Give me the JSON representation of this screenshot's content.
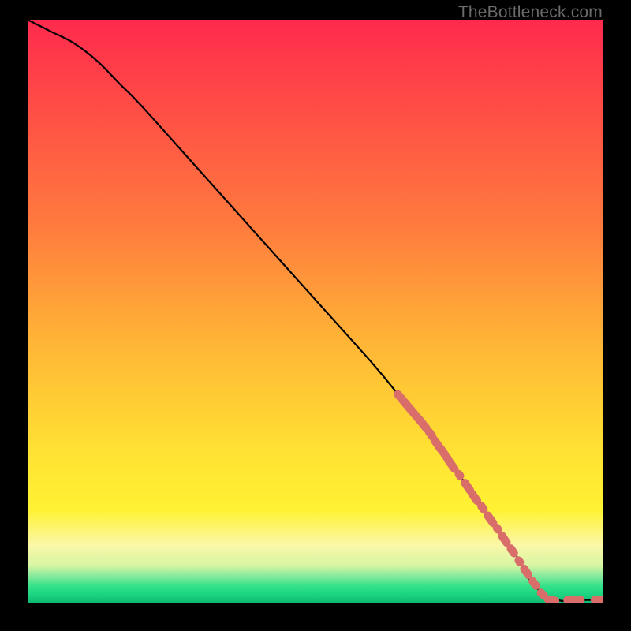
{
  "attribution": "TheBottleneck.com",
  "chart_data": {
    "type": "line",
    "title": "",
    "xlabel": "",
    "ylabel": "",
    "xlim": [
      0,
      100
    ],
    "ylim": [
      0,
      100
    ],
    "grid": false,
    "legend": false,
    "series": [
      {
        "name": "bottleneck-curve",
        "x": [
          0,
          4,
          8,
          12,
          16,
          20,
          30,
          40,
          50,
          60,
          65,
          70,
          75,
          80,
          85,
          88,
          92,
          96,
          100
        ],
        "y": [
          100,
          98,
          96,
          93,
          89,
          85,
          74,
          63,
          52,
          41,
          35,
          29,
          22,
          15,
          8,
          3,
          0.6,
          0.6,
          0.6
        ]
      }
    ],
    "markers": {
      "name": "highlighted-segment",
      "color": "#d96d6a",
      "points": [
        {
          "x": 65.0,
          "y": 35.0,
          "w": 2.4
        },
        {
          "x": 66.2,
          "y": 33.6,
          "w": 2.4
        },
        {
          "x": 67.4,
          "y": 32.2,
          "w": 2.4
        },
        {
          "x": 68.6,
          "y": 30.8,
          "w": 2.4
        },
        {
          "x": 70.0,
          "y": 29.0,
          "w": 1.6
        },
        {
          "x": 71.2,
          "y": 27.2,
          "w": 2.2
        },
        {
          "x": 72.4,
          "y": 25.6,
          "w": 2.2
        },
        {
          "x": 73.6,
          "y": 23.8,
          "w": 2.2
        },
        {
          "x": 75.0,
          "y": 22.0,
          "w": 1.2
        },
        {
          "x": 76.4,
          "y": 20.0,
          "w": 2.0
        },
        {
          "x": 77.6,
          "y": 18.2,
          "w": 2.0
        },
        {
          "x": 79.0,
          "y": 16.4,
          "w": 1.4
        },
        {
          "x": 80.4,
          "y": 14.4,
          "w": 2.0
        },
        {
          "x": 81.6,
          "y": 12.8,
          "w": 1.2
        },
        {
          "x": 82.8,
          "y": 11.0,
          "w": 1.9
        },
        {
          "x": 84.2,
          "y": 9.0,
          "w": 1.6
        },
        {
          "x": 85.4,
          "y": 7.2,
          "w": 1.2
        },
        {
          "x": 86.6,
          "y": 5.4,
          "w": 1.8
        },
        {
          "x": 88.0,
          "y": 3.4,
          "w": 1.6
        },
        {
          "x": 89.4,
          "y": 1.6,
          "w": 1.4
        },
        {
          "x": 91.0,
          "y": 0.6,
          "w": 1.8
        },
        {
          "x": 94.4,
          "y": 0.6,
          "w": 1.8
        },
        {
          "x": 96.0,
          "y": 0.6,
          "w": 1.0
        },
        {
          "x": 99.0,
          "y": 0.6,
          "w": 1.6
        }
      ]
    },
    "background_gradient": {
      "stops": [
        {
          "pos": 0.0,
          "color": "#ff2a4d"
        },
        {
          "pos": 0.35,
          "color": "#ff7a3e"
        },
        {
          "pos": 0.74,
          "color": "#ffe233"
        },
        {
          "pos": 0.9,
          "color": "#fbf7a8"
        },
        {
          "pos": 0.97,
          "color": "#35e28a"
        },
        {
          "pos": 1.0,
          "color": "#0fb36e"
        }
      ]
    }
  }
}
